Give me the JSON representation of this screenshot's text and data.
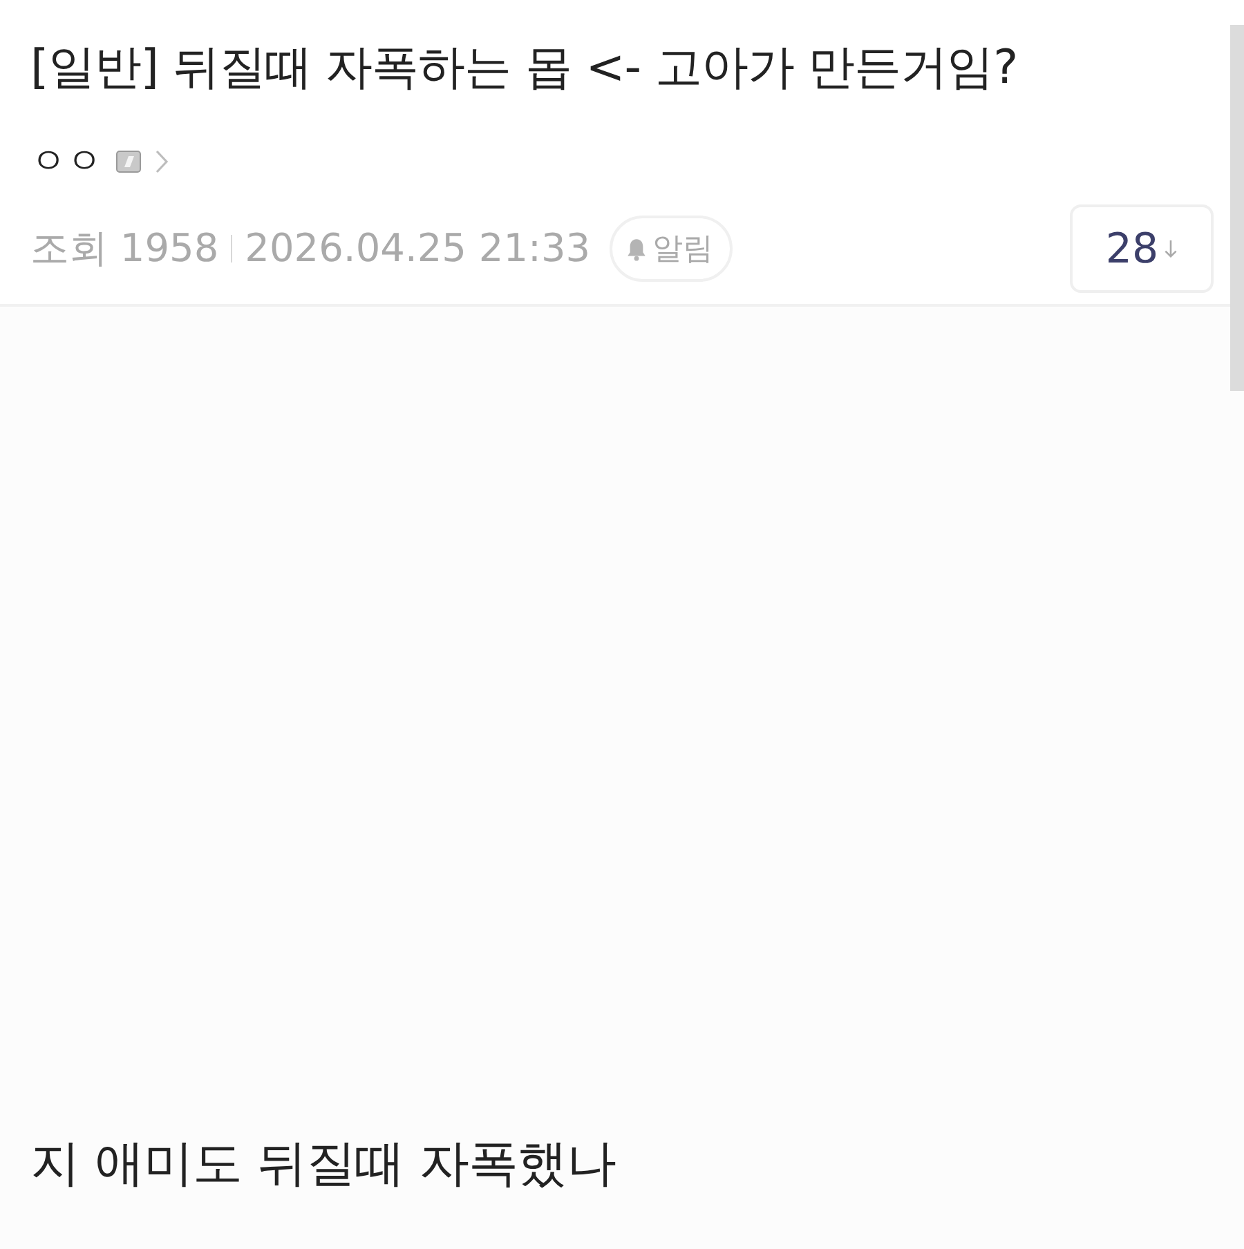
{
  "post": {
    "title": "[일반] 뒤질때 자폭하는 몹 <- 고아가 만든거임?",
    "author": {
      "name": "ㅇㅇ"
    },
    "meta": {
      "views_label": "조회",
      "views": "1958",
      "date": "2026.04.25 21:33",
      "alarm_button": "알림"
    },
    "comment_count": "28",
    "body": [
      {
        "kind": "text",
        "text": "지 애미도 뒤질때 자폭했나"
      }
    ]
  }
}
